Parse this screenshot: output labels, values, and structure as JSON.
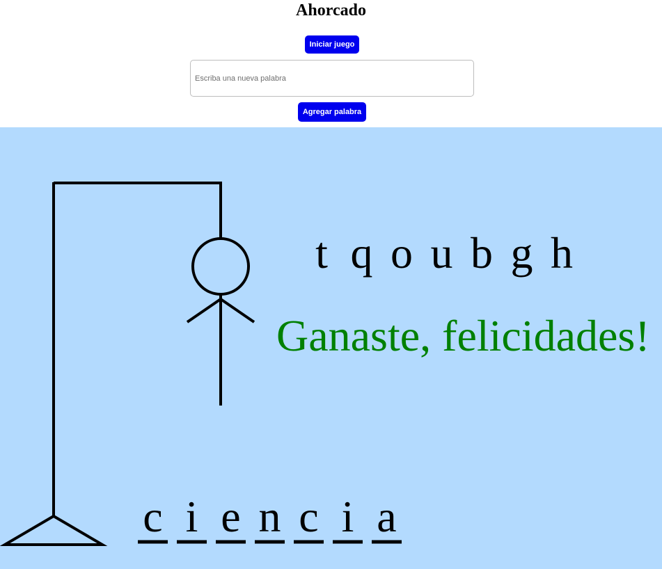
{
  "title": "Ahorcado",
  "controls": {
    "start_label": "Iniciar juego",
    "input_value": "",
    "input_placeholder": "Escriba una nueva palabra",
    "add_label": "Agregar palabra"
  },
  "game": {
    "wrong_letters": [
      "t",
      "q",
      "o",
      "u",
      "b",
      "g",
      "h"
    ],
    "message": "Ganaste, felicidades!",
    "word_letters": [
      "c",
      "i",
      "e",
      "n",
      "c",
      "i",
      "a"
    ]
  },
  "colors": {
    "button": "#0000ee",
    "board_background": "#b3dafe",
    "stroke": "#000000",
    "message": "#008000"
  }
}
